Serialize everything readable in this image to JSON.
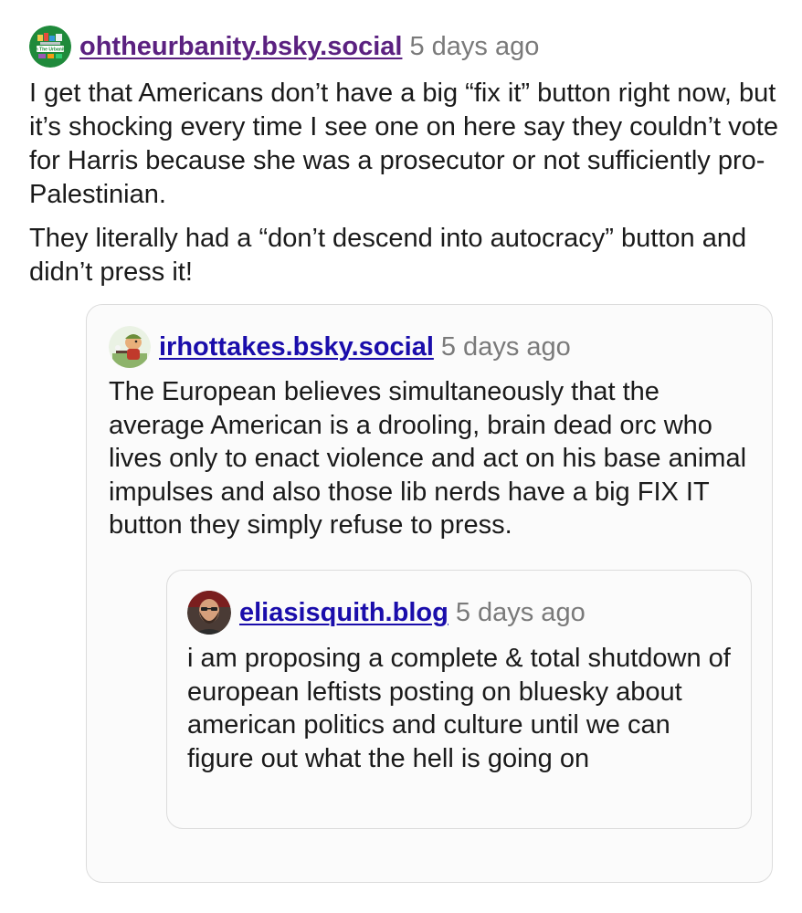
{
  "post": {
    "author": {
      "handle": "ohtheurbanity.bsky.social",
      "avatar_icon": "oh-the-urbanity-logo-avatar",
      "avatar_text": "Oh The Urbanity!"
    },
    "timestamp": "5 days ago",
    "paragraphs": [
      "I get that Americans don’t have a big “fix it” button right now, but it’s shocking every time I see one on here say they couldn’t vote for Harris because she was a prosecutor or not sufficiently pro-Palestinian.",
      "They literally had a “don’t descend into autocracy” button and didn’t press it!"
    ]
  },
  "quote": {
    "author": {
      "handle": "irhottakes.bsky.social",
      "avatar_icon": "cartoon-character-avatar"
    },
    "timestamp": "5 days ago",
    "text": "The European believes simultaneously that the average American is a drooling, brain dead orc who lives only to enact violence and act on his base animal impulses and also those lib nerds have a big FIX IT button they simply refuse to press.",
    "nested_quote": {
      "author": {
        "handle": "eliasisquith.blog",
        "avatar_icon": "bearded-man-photo-avatar"
      },
      "timestamp": "5 days ago",
      "text": "i am proposing a complete & total shutdown of european leftists posting on bluesky about american politics and culture until we can figure out what the hell is going on"
    }
  },
  "colors": {
    "main_handle": "#5b2180",
    "quote_handle": "#1a0dab",
    "timestamp": "#7a7a7a",
    "quote_border": "#dcdcdc",
    "quote_background": "#fbfbfb"
  }
}
